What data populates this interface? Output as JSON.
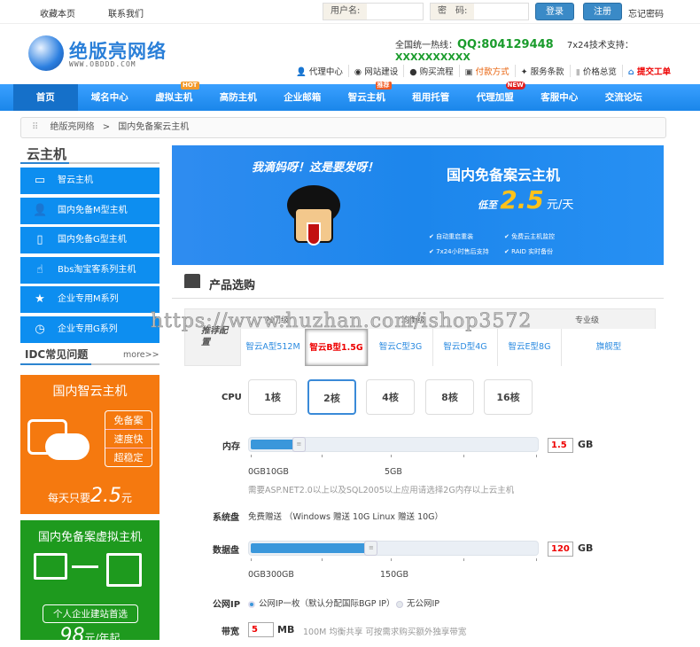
{
  "topbar": {
    "bookmark": "收藏本页",
    "contact": "联系我们",
    "username_label": "用户名:",
    "username_value": "",
    "password_label": "密　码:",
    "password_value": "",
    "login": "登录",
    "register": "注册",
    "forgot": "忘记密码"
  },
  "header": {
    "logo_text": "绝版亮网络",
    "logo_url": "WWW.OBDDD.COM",
    "hotline_label": "全国统一热线：",
    "hotline_value": "QQ:804129448",
    "support_label": "7x24技术支持：",
    "support_value": "XXXXXXXXXX",
    "links": [
      {
        "icon": "user-icon",
        "label": "代理中心"
      },
      {
        "icon": "globe-icon",
        "label": "网站建设"
      },
      {
        "icon": "pin-icon",
        "label": "购买流程"
      },
      {
        "icon": "calendar-icon",
        "label": "付款方式",
        "color": "#e8620c"
      },
      {
        "icon": "pushpin-icon",
        "label": "服务条款"
      },
      {
        "icon": "list-icon",
        "label": "价格总览"
      },
      {
        "icon": "home-icon",
        "label": "提交工单",
        "color": "#e00"
      }
    ]
  },
  "nav": {
    "items": [
      {
        "label": "首页"
      },
      {
        "label": "域名中心"
      },
      {
        "label": "虚拟主机",
        "badge": "HOT"
      },
      {
        "label": "高防主机"
      },
      {
        "label": "企业邮箱"
      },
      {
        "label": "智云主机",
        "badge": "推荐"
      },
      {
        "label": "租用托管"
      },
      {
        "label": "代理加盟",
        "badge": "NEW"
      },
      {
        "label": "客服中心"
      },
      {
        "label": "交流论坛"
      }
    ]
  },
  "breadcrumb": {
    "home": "绝版亮网络",
    "sep": ">",
    "current": "国内免备案云主机"
  },
  "sidebar": {
    "title": "云主机",
    "items": [
      {
        "icon": "monitor-icon",
        "label": "智云主机"
      },
      {
        "icon": "user-icon",
        "label": "国内免备M型主机"
      },
      {
        "icon": "document-icon",
        "label": "国内免备G型主机"
      },
      {
        "icon": "hand-pointer-icon",
        "label": "Bbs淘宝客系列主机"
      },
      {
        "icon": "star-icon",
        "label": "企业专用M系列"
      },
      {
        "icon": "clock-icon",
        "label": "企业专用G系列"
      }
    ],
    "faq_title": "IDC常见问题",
    "faq_more": "more>>",
    "promo1": {
      "title": "国内智云主机",
      "tags": [
        "免备案",
        "速度快",
        "超稳定"
      ],
      "price_prefix": "每天只要",
      "price": "2.5",
      "price_unit": "元"
    },
    "promo2": {
      "title": "国内免备案虚拟主机",
      "tag": "个人企业建站首选",
      "price": "98",
      "price_unit": "元/年起"
    }
  },
  "banner": {
    "slogan": "我滴妈呀！这是要发呀！",
    "title": "国内免备案云主机",
    "price_prefix": "低至",
    "price": "2.5",
    "price_unit": "元/天",
    "features": [
      "自动重启重装",
      "免费云主机监控",
      "7x24小时售后支持",
      "RAID 实时备份"
    ]
  },
  "product": {
    "title": "产品选购",
    "config": {
      "label": "推荐配置",
      "groups": [
        "入门级",
        "均衡级",
        "专业级"
      ],
      "options": [
        "智云A型512M",
        "智云B型1.5G",
        "智云C型3G",
        "智云D型4G",
        "智云E型8G",
        "旗舰型"
      ],
      "selected": 1
    },
    "cpu": {
      "label": "CPU",
      "options": [
        "1核",
        "2核",
        "4核",
        "8核",
        "16核"
      ],
      "selected": 1
    },
    "memory": {
      "label": "内存",
      "value": "1.5",
      "unit": "GB",
      "fraction": 0.15,
      "scale_labels": [
        "0GB10GB",
        "5GB"
      ],
      "note": "需要ASP.NET2.0以上以及SQL2005以上应用请选择2G内存以上云主机"
    },
    "system_disk": {
      "label": "系统盘",
      "text": "免费赠送 （Windows 赠送 10G Linux 赠送 10G）"
    },
    "data_disk": {
      "label": "数据盘",
      "value": "120",
      "unit": "GB",
      "fraction": 0.4,
      "scale_labels": [
        "0GB300GB",
        "150GB"
      ]
    },
    "public_ip": {
      "label": "公网IP",
      "options": [
        "公网IP一枚（默认分配国际BGP IP）",
        "无公网IP"
      ],
      "selected": 0
    },
    "bandwidth": {
      "label": "带宽",
      "value": "5",
      "unit": "MB",
      "note": "100M 均衡共享 可按需求购买额外独享带宽"
    }
  },
  "watermark": "https://www.huzhan.com/ishop3572"
}
